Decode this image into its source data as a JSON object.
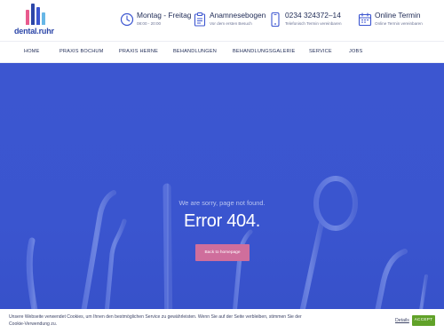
{
  "brand": {
    "logo_text": "dental.ruhr",
    "bar_colors": [
      "#e85a8d",
      "#2c46a8",
      "#3c56d0",
      "#67b7e6"
    ],
    "bar_heights": [
      0.7,
      1.0,
      0.85,
      0.6
    ]
  },
  "header": {
    "hours": {
      "icon": "clock-icon",
      "title": "Montag - Freitag",
      "subtitle": "08:00 - 20:00"
    },
    "anamnese": {
      "icon": "clipboard-icon",
      "title": "Anamnesebogen",
      "subtitle": "Vor dem ersten Besuch"
    },
    "phone": {
      "icon": "phone-icon",
      "title": "0234 324372–14",
      "subtitle": "Telefonisch Termin vereinbaren"
    },
    "online": {
      "icon": "calendar-icon",
      "title": "Online Termin",
      "subtitle": "Online Termin vereinbaren"
    }
  },
  "nav": {
    "items": [
      {
        "label": "HOME"
      },
      {
        "label": "PRAXIS BOCHUM"
      },
      {
        "label": "PRAXIS HERNE"
      },
      {
        "label": "BEHANDLUNGEN"
      },
      {
        "label": "BEHANDLUNGSGALERIE"
      },
      {
        "label": "SERVICE"
      },
      {
        "label": "JOBS"
      }
    ]
  },
  "hero": {
    "sorry_text": "We are sorry, page not found.",
    "error_title": "Error 404.",
    "back_button": "Back to homepage",
    "background_color": "#3c56d0",
    "button_color": "#cf6e9c"
  },
  "cookie": {
    "text": "Unsere Webseite verwendet Cookies, um Ihnen den bestmöglichen Service zu gewährleisten. Wenn Sie auf der Seite verbleiben, stimmen Sie der Cookie-Verwendung zu.",
    "settings_label": "Details",
    "accept_label": "ACCEPT",
    "accept_color": "#61a229"
  }
}
